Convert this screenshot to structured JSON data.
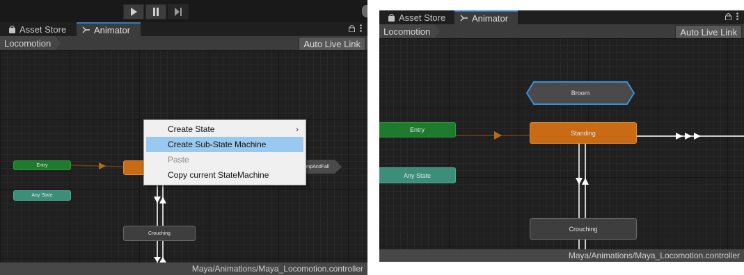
{
  "toolbar": {
    "play_icon": "play-icon",
    "pause_icon": "pause-icon",
    "step_icon": "step-icon"
  },
  "tabs": [
    {
      "label": "Asset Store",
      "icon": "bag-icon"
    },
    {
      "label": "Animator",
      "icon": "animator-icon"
    }
  ],
  "tab_tools": {
    "lock_icon": "lock-icon",
    "menu_icon": "kebab-menu-icon"
  },
  "breadcrumb": "Locomotion",
  "auto_live_link": "Auto Live Link",
  "status_path": "Maya/Animations/Maya_Locomotion.controller",
  "left_graph": {
    "states": {
      "entry": "Entry",
      "any_state": "Any State",
      "crouching": "Crouching",
      "jump": "JumpAndFall"
    }
  },
  "right_graph": {
    "states": {
      "broom": "Broom",
      "entry": "Entry",
      "standing": "Standing",
      "any_state": "Any State",
      "crouching": "Crouching"
    }
  },
  "context_menu": {
    "items": [
      {
        "label": "Create State",
        "submenu": true,
        "highlighted": false,
        "disabled": false
      },
      {
        "label": "Create Sub-State Machine",
        "submenu": false,
        "highlighted": true,
        "disabled": false
      },
      {
        "label": "Paste",
        "submenu": false,
        "highlighted": false,
        "disabled": true
      },
      {
        "label": "Copy current StateMachine",
        "submenu": false,
        "highlighted": false,
        "disabled": false
      }
    ],
    "submenu_glyph": "›"
  },
  "colors": {
    "entry": "#1f7a2e",
    "any_state": "#3b8f7a",
    "default_state": "#c96a15",
    "state": "#3e3e3e",
    "menu_highlight": "#99c9ef",
    "tab_accent": "#3a79bb",
    "sub_state_outline": "#3a8fd8"
  }
}
